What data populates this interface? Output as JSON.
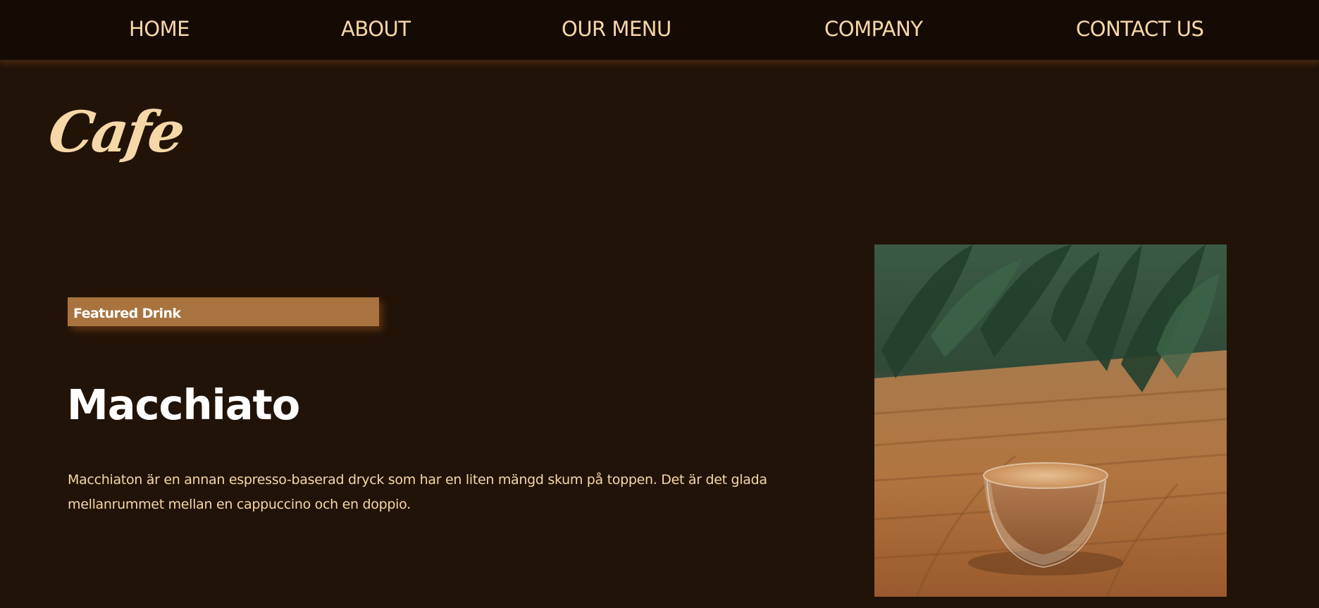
{
  "nav": {
    "items": [
      {
        "label": "HOME"
      },
      {
        "label": "ABOUT"
      },
      {
        "label": "OUR MENU"
      },
      {
        "label": "COMPANY"
      },
      {
        "label": "CONTACT US"
      }
    ]
  },
  "logo": {
    "text": "Cafe"
  },
  "featured": {
    "badge": "Featured Drink",
    "title": "Macchiato",
    "description": "Macchiaton är en annan espresso-baserad dryck som har en liten mängd skum på toppen. Det är det glada mellanrummet mellan en cappuccino och en doppio."
  },
  "colors": {
    "background": "#221308",
    "navbar": "#160b04",
    "accent_text": "#f6d7a7",
    "badge": "#a8733f"
  }
}
